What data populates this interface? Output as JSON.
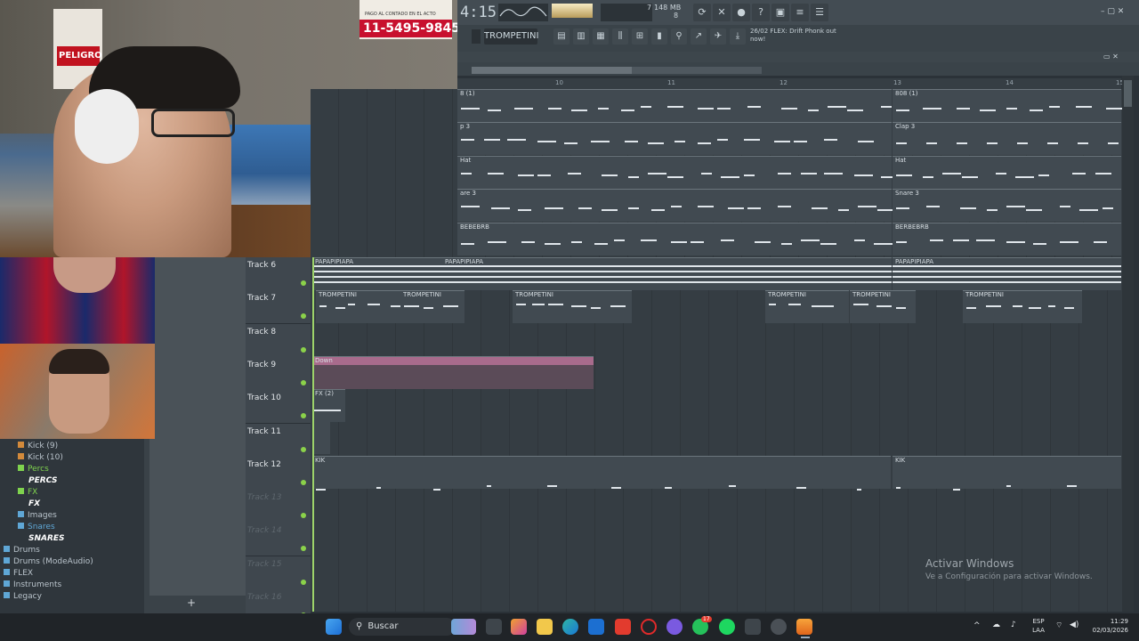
{
  "transport": {
    "time": "4:15",
    "mem": "148 MB",
    "cpu_a": "7",
    "cpu_b": "8"
  },
  "toolbar": {
    "pattern": "TROMPETINI",
    "news": "26/02  FLEX: Drift Phonk out now!"
  },
  "ruler": [
    "10",
    "11",
    "12",
    "13",
    "14",
    "15"
  ],
  "browser": {
    "items": [
      {
        "label": "Kick (9)",
        "color": "#d38a3b",
        "style": "normal"
      },
      {
        "label": "Kick (10)",
        "color": "#d38a3b",
        "style": "normal"
      },
      {
        "label": "Percs",
        "color": "#7fd34e",
        "style": "folder-open"
      },
      {
        "label": "PERCS",
        "color": "#ffffff",
        "style": "bold"
      },
      {
        "label": "FX",
        "color": "#7fd34e",
        "style": "folder-open"
      },
      {
        "label": "FX",
        "color": "#ffffff",
        "style": "bold"
      },
      {
        "label": "Images",
        "color": "#5fa7d6",
        "style": "normal"
      },
      {
        "label": "Snares",
        "color": "#5fa7d6",
        "style": "folder-open"
      },
      {
        "label": "SNARES",
        "color": "#ffffff",
        "style": "bold"
      },
      {
        "label": "Drums",
        "color": "#5fa7d6",
        "style": "folder"
      },
      {
        "label": "Drums (ModeAudio)",
        "color": "#5fa7d6",
        "style": "folder"
      },
      {
        "label": "FLEX",
        "color": "#5fa7d6",
        "style": "folder"
      },
      {
        "label": "Instruments",
        "color": "#5fa7d6",
        "style": "folder"
      },
      {
        "label": "Legacy",
        "color": "#5fa7d6",
        "style": "folder"
      }
    ]
  },
  "tracks": [
    {
      "label": "Track 6",
      "dim": false
    },
    {
      "label": "Track 7",
      "dim": false
    },
    {
      "label": "Track 8",
      "dim": false
    },
    {
      "label": "Track 9",
      "dim": false
    },
    {
      "label": "Track 10",
      "dim": false
    },
    {
      "label": "Track 11",
      "dim": false
    },
    {
      "label": "Track 12",
      "dim": false
    },
    {
      "label": "Track 13",
      "dim": true
    },
    {
      "label": "Track 14",
      "dim": true
    },
    {
      "label": "Track 15",
      "dim": true
    },
    {
      "label": "Track 16",
      "dim": true
    }
  ],
  "clips_upper": [
    {
      "label": "8 (1)"
    },
    {
      "label": "808 (1)"
    },
    {
      "label": "p 3"
    },
    {
      "label": "Clap 3"
    },
    {
      "label": "Hat"
    },
    {
      "label": "are 3"
    },
    {
      "label": "Snare 3"
    },
    {
      "label": "BEBEBRB"
    },
    {
      "label": "BERBEBRB"
    }
  ],
  "clips": {
    "papapipiapa": "PAPAPIPIAPA",
    "trompetini": "TROMPETINI",
    "down": "Down",
    "fx": "FX (2)",
    "kik": "KIK"
  },
  "watermark": {
    "title": "Activar Windows",
    "subtitle": "Ve a Configuración para activar Windows."
  },
  "webcam": {
    "sign_line1": "PAGO AL CONTADO EN EL ACTO",
    "sign_line2": "11-5495-9845",
    "poster": "PELIGRO"
  },
  "taskbar": {
    "search": "Buscar",
    "lang1": "ESP",
    "lang2": "LAA",
    "time": "11:29",
    "date": "02/03/2026",
    "badge": "17"
  }
}
